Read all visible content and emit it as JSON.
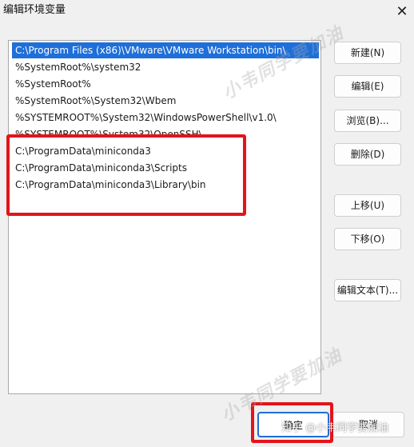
{
  "window": {
    "title": "编辑环境变量",
    "close_glyph": "✕"
  },
  "path_list": {
    "items": [
      "C:\\Program Files (x86)\\VMware\\VMware Workstation\\bin\\",
      "%SystemRoot%\\system32",
      "%SystemRoot%",
      "%SystemRoot%\\System32\\Wbem",
      "%SYSTEMROOT%\\System32\\WindowsPowerShell\\v1.0\\",
      "%SYSTEMROOT%\\System32\\OpenSSH\\",
      "C:\\ProgramData\\miniconda3",
      "C:\\ProgramData\\miniconda3\\Scripts",
      "C:\\ProgramData\\miniconda3\\Library\\bin"
    ],
    "selected_index": 0
  },
  "buttons": {
    "new": "新建(N)",
    "edit": "编辑(E)",
    "browse": "浏览(B)...",
    "delete": "删除(D)",
    "move_up": "上移(U)",
    "move_down": "下移(O)",
    "edit_text": "编辑文本(T)...",
    "ok": "确定",
    "cancel": "取消"
  },
  "annotations": {
    "highlight_color": "#e3141b"
  },
  "watermarks": {
    "top": "小韦同学要加油",
    "bottom": "小韦同学要加油",
    "zhihu": "知乎 @小韦同学要加油"
  },
  "colors": {
    "selection": "#1e6fd9",
    "dialog_bg": "#f0f0f0"
  }
}
